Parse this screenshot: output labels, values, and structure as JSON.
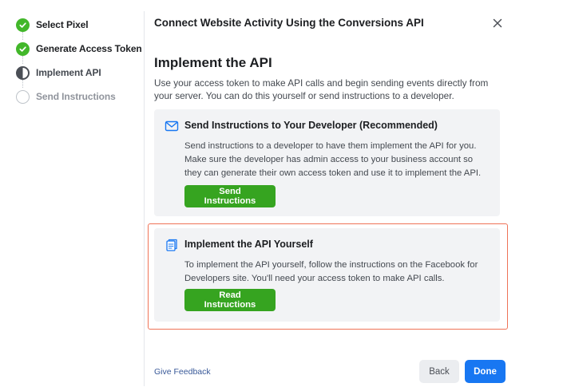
{
  "sidebar": {
    "steps": [
      {
        "label": "Select Pixel",
        "state": "done"
      },
      {
        "label": "Generate Access Token",
        "state": "done"
      },
      {
        "label": "Implement API",
        "state": "current"
      },
      {
        "label": "Send Instructions",
        "state": "pending"
      }
    ]
  },
  "header": {
    "title": "Connect Website Activity Using the Conversions API",
    "close_icon": "close-icon"
  },
  "main": {
    "heading": "Implement the API",
    "intro": "Use your access token to make API calls and begin sending events directly from your server. You can do this yourself or send instructions to a developer.",
    "cards": [
      {
        "icon": "envelope-icon",
        "title": "Send Instructions to Your Developer (Recommended)",
        "description": "Send instructions to a developer to have them implement the API for you. Make sure the developer has admin access to your business account so they can generate their own access token and use it to implement the API.",
        "button_label": "Send Instructions"
      },
      {
        "icon": "document-icon",
        "title": "Implement the API Yourself",
        "description": "To implement the API yourself, follow the instructions on the Facebook for Developers site. You'll need your access token to make API calls.",
        "button_label": "Read Instructions",
        "highlighted": true
      }
    ]
  },
  "footer": {
    "feedback_label": "Give Feedback",
    "back_label": "Back",
    "done_label": "Done"
  },
  "colors": {
    "green": "#36a420",
    "step_done": "#42b72a",
    "primary_blue": "#1877f2",
    "highlight": "#ef7357",
    "link": "#385898"
  }
}
